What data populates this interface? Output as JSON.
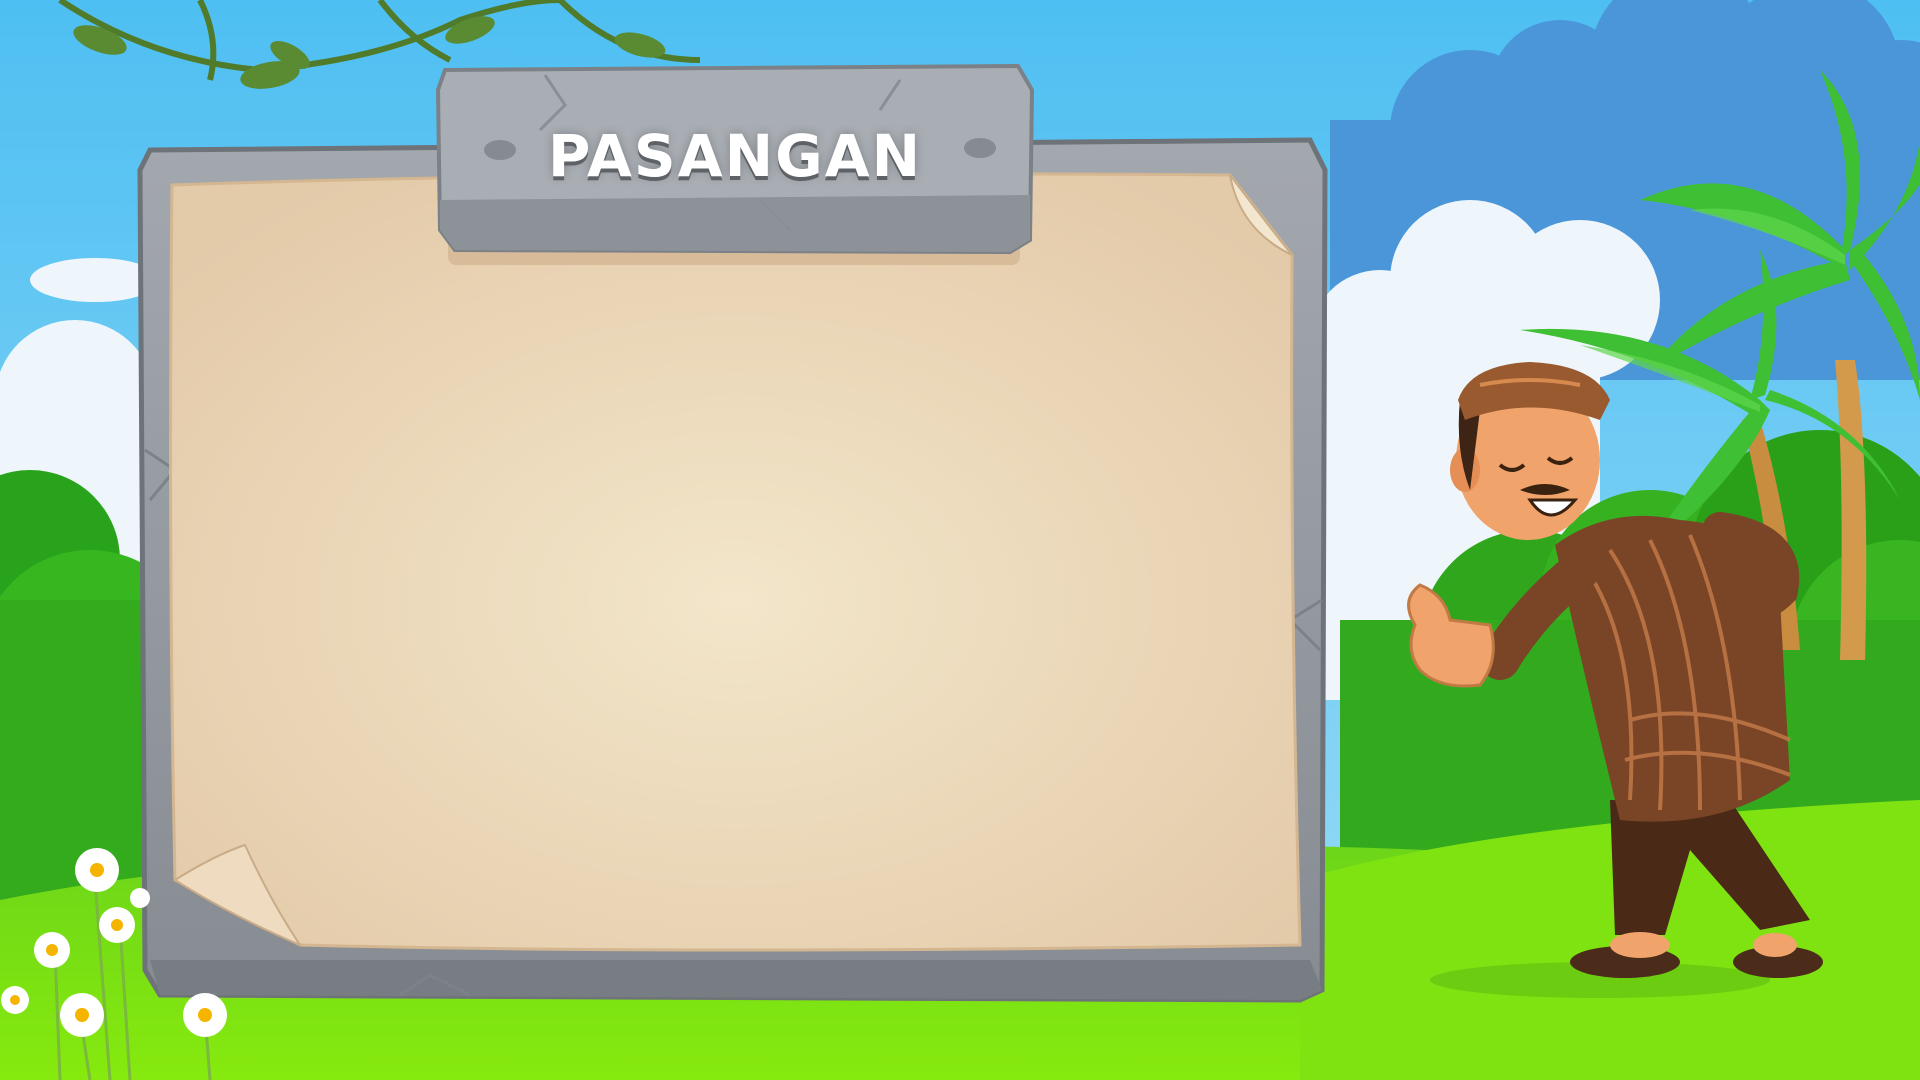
{
  "board": {
    "title": "PASANGAN"
  },
  "colors": {
    "sky_top": "#4fc1f2",
    "sky_bottom": "#8fd9f7",
    "grass_light": "#7be10f",
    "grass_dark": "#2fa11a",
    "stone": "#9a9fa6",
    "stone_dark": "#6e7379",
    "paper_center": "#f2e3c5",
    "paper_edge": "#e2c9a8",
    "shirt_brown": "#7a4526",
    "skin": "#f0a36b"
  },
  "icons": [
    "vine-icon",
    "palm-tree-icon",
    "daisy-icon",
    "character-icon"
  ]
}
